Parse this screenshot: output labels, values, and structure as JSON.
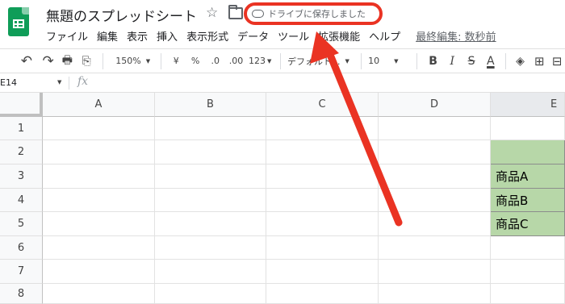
{
  "header": {
    "doc_title": "無題のスプレッドシート",
    "save_status": "ドライブに保存しました",
    "star_glyph": "☆"
  },
  "menu": {
    "items": [
      "ファイル",
      "編集",
      "表示",
      "挿入",
      "表示形式",
      "データ",
      "ツール",
      "拡張機能",
      "ヘルプ"
    ],
    "last_edit": "最終編集: 数秒前"
  },
  "toolbar": {
    "undo": "↶",
    "redo": "↷",
    "print": "🖶",
    "paint_format": "⎘",
    "zoom": "150%",
    "currency": "¥",
    "percent": "%",
    "dec_decrease": ".0",
    "dec_increase": ".00",
    "number_format": "123",
    "font": "デフォルト...",
    "font_size": "10",
    "bold": "B",
    "italic": "I",
    "strike": "S",
    "text_color": "A"
  },
  "formula_bar": {
    "name_box": "E14",
    "fx": "fx"
  },
  "grid": {
    "columns": [
      "A",
      "B",
      "C",
      "D",
      "E"
    ],
    "rows": [
      "1",
      "2",
      "3",
      "4",
      "5",
      "6",
      "7",
      "8"
    ],
    "e_cells": [
      "",
      "",
      "商品A",
      "商品B",
      "商品C"
    ],
    "fill_color": "#b7d7a8",
    "highlight_color": "#ea3323"
  }
}
